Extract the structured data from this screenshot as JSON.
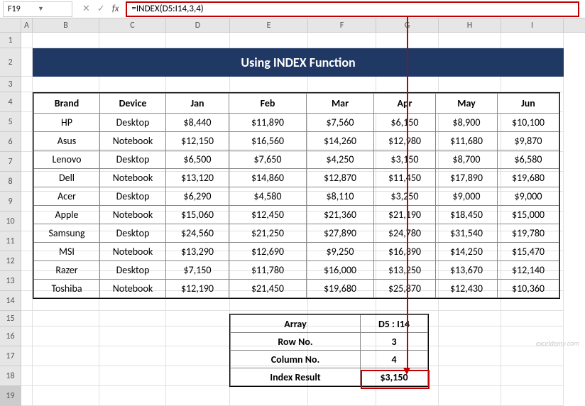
{
  "name_box": "F19",
  "formula": "=INDEX(D5:I14,3,4)",
  "columns": [
    "A",
    "B",
    "C",
    "D",
    "E",
    "F",
    "G",
    "H",
    "I"
  ],
  "rows": [
    "1",
    "2",
    "3",
    "4",
    "5",
    "6",
    "7",
    "8",
    "9",
    "10",
    "11",
    "12",
    "13",
    "14",
    "15",
    "16",
    "17",
    "18",
    "19"
  ],
  "banner_title": "Using INDEX Function",
  "headers": {
    "b": "Brand",
    "c": "Device",
    "d": "Jan",
    "e": "Feb",
    "f": "Mar",
    "g": "Apr",
    "h": "May",
    "i": "Jun"
  },
  "data": [
    {
      "b": "HP",
      "c": "Desktop",
      "d": "$8,440",
      "e": "$11,890",
      "f": "$7,560",
      "g": "$6,150",
      "h": "$8,900",
      "i": "$10,100"
    },
    {
      "b": "Asus",
      "c": "Notebook",
      "d": "$12,150",
      "e": "$16,560",
      "f": "$14,260",
      "g": "$12,980",
      "h": "$11,680",
      "i": "$9,870"
    },
    {
      "b": "Lenovo",
      "c": "Desktop",
      "d": "$6,500",
      "e": "$7,650",
      "f": "$4,250",
      "g": "$3,150",
      "h": "$8,700",
      "i": "$6,580"
    },
    {
      "b": "Dell",
      "c": "Notebook",
      "d": "$13,120",
      "e": "$14,860",
      "f": "$12,870",
      "g": "$11,450",
      "h": "$17,890",
      "i": "$19,680"
    },
    {
      "b": "Acer",
      "c": "Desktop",
      "d": "$6,290",
      "e": "$4,580",
      "f": "$8,110",
      "g": "$3,250",
      "h": "$9,000",
      "i": "$9,000"
    },
    {
      "b": "Apple",
      "c": "Notebook",
      "d": "$15,060",
      "e": "$12,450",
      "f": "$21,360",
      "g": "$21,190",
      "h": "$18,450",
      "i": "$15,000"
    },
    {
      "b": "Samsung",
      "c": "Desktop",
      "d": "$24,560",
      "e": "$21,250",
      "f": "$27,890",
      "g": "$24,780",
      "h": "$31,540",
      "i": "$19,780"
    },
    {
      "b": "MSI",
      "c": "Notebook",
      "d": "$13,290",
      "e": "$12,690",
      "f": "$9,250",
      "g": "$16,390",
      "h": "$14,250",
      "i": "$15,470"
    },
    {
      "b": "Razer",
      "c": "Desktop",
      "d": "$7,150",
      "e": "$11,780",
      "f": "$16,000",
      "g": "$13,250",
      "h": "$13,670",
      "i": "$12,140"
    },
    {
      "b": "Toshiba",
      "c": "Notebook",
      "d": "$12,190",
      "e": "$21,450",
      "f": "$19,680",
      "g": "$25,870",
      "h": "$12,430",
      "i": "$10,360"
    }
  ],
  "summary": {
    "array_lbl": "Array",
    "array_val": "D5 : I14",
    "row_lbl": "Row No.",
    "row_val": "3",
    "col_lbl": "Column No.",
    "col_val": "4",
    "result_lbl": "Index Result",
    "result_val": "$3,150"
  },
  "watermark": "exceldemy.com",
  "chart_data": {
    "type": "table",
    "title": "Using INDEX Function",
    "columns": [
      "Brand",
      "Device",
      "Jan",
      "Feb",
      "Mar",
      "Apr",
      "May",
      "Jun"
    ],
    "rows": [
      [
        "HP",
        "Desktop",
        8440,
        11890,
        7560,
        6150,
        8900,
        10100
      ],
      [
        "Asus",
        "Notebook",
        12150,
        16560,
        14260,
        12980,
        11680,
        9870
      ],
      [
        "Lenovo",
        "Desktop",
        6500,
        7650,
        4250,
        3150,
        8700,
        6580
      ],
      [
        "Dell",
        "Notebook",
        13120,
        14860,
        12870,
        11450,
        17890,
        19680
      ],
      [
        "Acer",
        "Desktop",
        6290,
        4580,
        8110,
        3250,
        9000,
        9000
      ],
      [
        "Apple",
        "Notebook",
        15060,
        12450,
        21360,
        21190,
        18450,
        15000
      ],
      [
        "Samsung",
        "Desktop",
        24560,
        21250,
        27890,
        24780,
        31540,
        19780
      ],
      [
        "MSI",
        "Notebook",
        13290,
        12690,
        9250,
        16390,
        14250,
        15470
      ],
      [
        "Razer",
        "Desktop",
        7150,
        11780,
        16000,
        13250,
        13670,
        12140
      ],
      [
        "Toshiba",
        "Notebook",
        12190,
        21450,
        19680,
        25870,
        12430,
        10360
      ]
    ],
    "index_params": {
      "array": "D5:I14",
      "row": 3,
      "column": 4,
      "result": 3150
    }
  }
}
